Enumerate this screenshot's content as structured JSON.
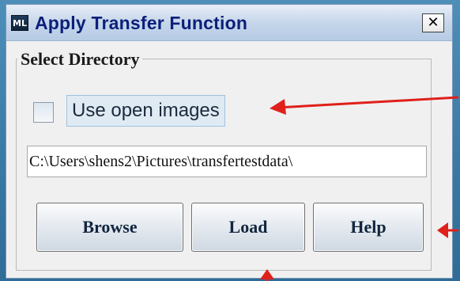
{
  "window": {
    "title": "Apply Transfer Function",
    "app_icon_text": "ML",
    "close_glyph": "✕"
  },
  "fieldset": {
    "legend": "Select Directory"
  },
  "use_open_images": {
    "label": "Use open images",
    "checked": false
  },
  "directory": {
    "value": "C:\\Users\\shens2\\Pictures\\transfertestdata\\"
  },
  "buttons": {
    "browse": "Browse",
    "load": "Load",
    "help": "Help"
  },
  "annotation_arrows": {
    "color": "#e0201a",
    "count": 3
  },
  "colors": {
    "background": "#3f7fa8",
    "title_text": "#0b1f7a",
    "arrow": "#e0201a"
  }
}
